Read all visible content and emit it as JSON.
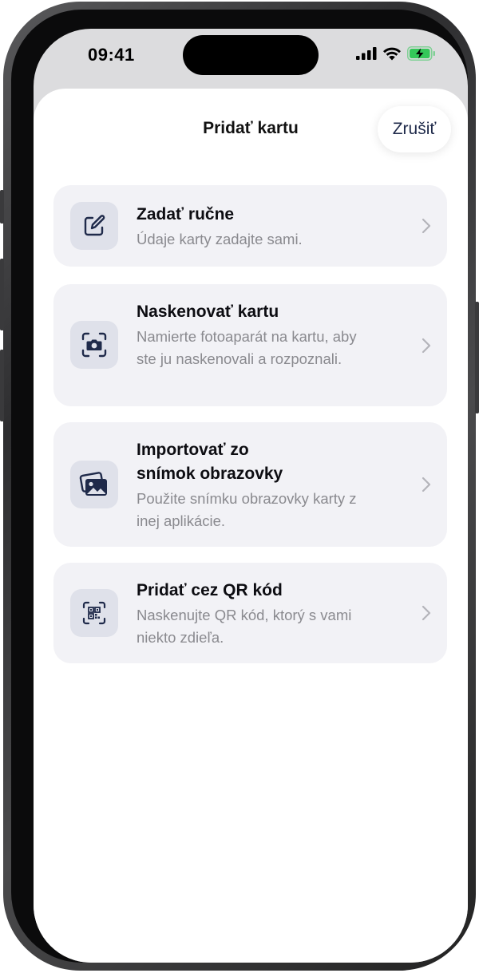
{
  "status_bar": {
    "time": "09:41",
    "signal_icon": "cellular-signal-icon",
    "wifi_icon": "wifi-icon",
    "battery_icon": "battery-charging-icon",
    "battery_color": "#34c759"
  },
  "sheet": {
    "title": "Pridať kartu",
    "cancel_label": "Zrušiť"
  },
  "options": [
    {
      "title": "Zadať ručne",
      "description": "Údaje karty zadajte sami.",
      "icon": "edit-icon"
    },
    {
      "title": "Naskenovať kartu",
      "description": "Namierte fotoaparát na kartu, aby ste ju naskenovali a rozpoznali.",
      "icon": "camera-scan-icon"
    },
    {
      "title": "Importovať zo snímok obrazovky",
      "description": "Použite snímku obrazovky karty z inej aplikácie.",
      "icon": "photos-icon"
    },
    {
      "title": "Pridať cez QR kód",
      "description": "Naskenujte QR kód, ktorý s vami niekto zdieľa.",
      "icon": "qr-scan-icon"
    }
  ],
  "colors": {
    "accent": "#1f2a4a",
    "card_bg": "#f2f2f6",
    "icon_bg": "#dfe1ea",
    "secondary_text": "#8a8a8f"
  }
}
